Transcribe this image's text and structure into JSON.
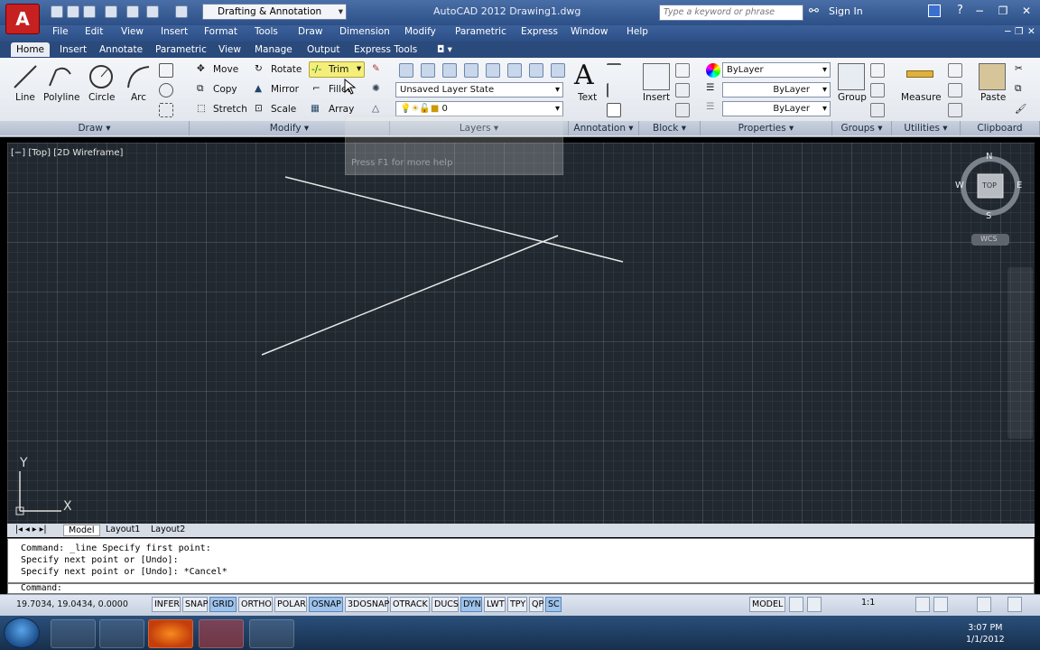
{
  "app": {
    "title": "AutoCAD 2012    Drawing1.dwg",
    "workspace": "Drafting & Annotation",
    "search_placeholder": "Type a keyword or phrase",
    "signin": "Sign In",
    "logo": "A"
  },
  "menu": [
    "File",
    "Edit",
    "View",
    "Insert",
    "Format",
    "Tools",
    "Draw",
    "Dimension",
    "Modify",
    "Parametric",
    "Express",
    "Window",
    "Help"
  ],
  "tabs": [
    "Home",
    "Insert",
    "Annotate",
    "Parametric",
    "View",
    "Manage",
    "Output",
    "Express Tools"
  ],
  "ribbon": {
    "draw": {
      "line": "Line",
      "polyline": "Polyline",
      "circle": "Circle",
      "arc": "Arc",
      "panel": "Draw ▾"
    },
    "modify": {
      "move": "Move",
      "rotate": "Rotate",
      "trim": "Trim",
      "copy": "Copy",
      "mirror": "Mirror",
      "fillet": "Fillet",
      "stretch": "Stretch",
      "scale": "Scale",
      "array": "Array",
      "panel": "Modify ▾"
    },
    "layers": {
      "state": "Unsaved Layer State",
      "current": "0",
      "panel": "Layers ▾"
    },
    "annotation": {
      "text": "Text",
      "panel": "Annotation ▾"
    },
    "block": {
      "insert": "Insert",
      "panel": "Block ▾"
    },
    "properties": {
      "color": "ByLayer",
      "linetype": "ByLayer",
      "lineweight": "ByLayer",
      "panel": "Properties ▾"
    },
    "groups": {
      "group": "Group",
      "panel": "Groups ▾"
    },
    "utilities": {
      "measure": "Measure",
      "panel": "Utilities ▾"
    },
    "clipboard": {
      "paste": "Paste",
      "panel": "Clipboard"
    }
  },
  "tooltip": {
    "help": "Press F1 for more help"
  },
  "viewport": {
    "label": "[−] [Top] [2D Wireframe]"
  },
  "viewcube": {
    "n": "N",
    "s": "S",
    "e": "E",
    "w": "W",
    "top": "TOP",
    "wcs": "WCS"
  },
  "ucs": {
    "x": "X",
    "y": "Y"
  },
  "layouts": [
    "Model",
    "Layout1",
    "Layout2"
  ],
  "command_history": [
    "Command: _line Specify first point:",
    "Specify next point or [Undo]:",
    "Specify next point or [Undo]: *Cancel*"
  ],
  "command_prompt": "Command:",
  "status": {
    "coords": "19.7034, 19.0434, 0.0000",
    "toggles": [
      {
        "label": "INFER",
        "on": false
      },
      {
        "label": "SNAP",
        "on": false
      },
      {
        "label": "GRID",
        "on": true
      },
      {
        "label": "ORTHO",
        "on": false
      },
      {
        "label": "POLAR",
        "on": false
      },
      {
        "label": "OSNAP",
        "on": true
      },
      {
        "label": "3DOSNAP",
        "on": false
      },
      {
        "label": "OTRACK",
        "on": false
      },
      {
        "label": "DUCS",
        "on": false
      },
      {
        "label": "DYN",
        "on": true
      },
      {
        "label": "LWT",
        "on": false
      },
      {
        "label": "TPY",
        "on": false
      },
      {
        "label": "QP",
        "on": false
      },
      {
        "label": "SC",
        "on": true
      }
    ],
    "model": "MODEL",
    "scale": "1:1"
  },
  "taskbar": {
    "time": "3:07 PM",
    "date": "1/1/2012"
  },
  "colors": {
    "canvas": "#212830",
    "titlebar": "#2b4f86",
    "ribbon": "#e4e8ee",
    "autocad_red": "#c62020",
    "toggle_on": "#9ec3ec"
  }
}
